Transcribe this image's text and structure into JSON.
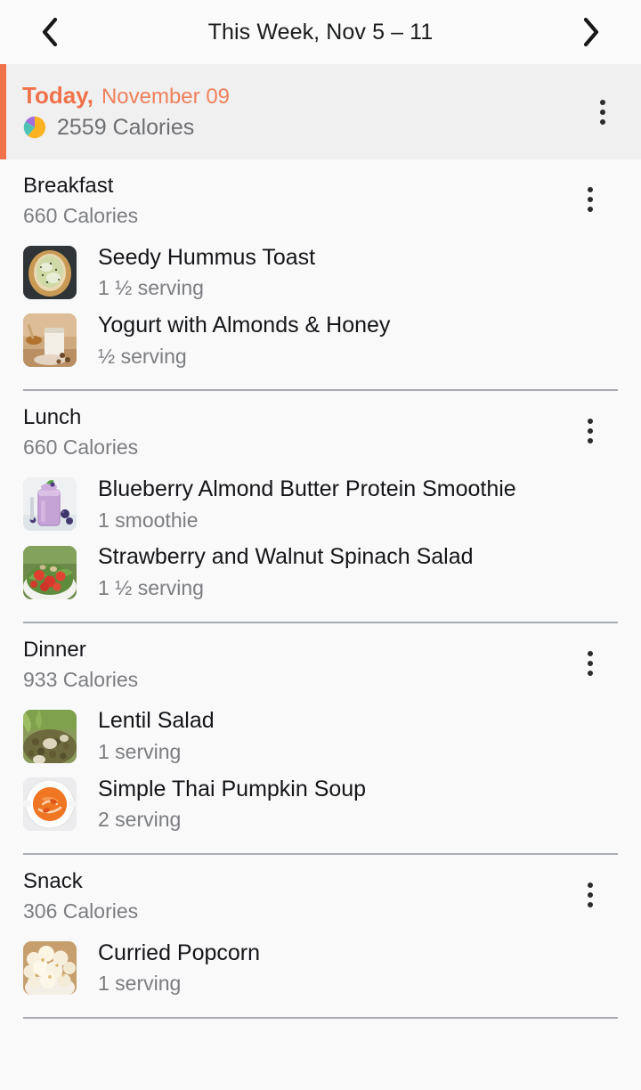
{
  "topbar": {
    "prev_label": "‹",
    "next_label": "›",
    "title": "This Week, Nov 5 – 11"
  },
  "today": {
    "label": "Today,",
    "date": "November 09",
    "calories": "2559 Calories",
    "accent_color": "#f0724a",
    "pie_colors": [
      "#a36fdd",
      "#fbb323",
      "#4ec3b6"
    ]
  },
  "meals": [
    {
      "name": "Breakfast",
      "calories": "660 Calories",
      "items": [
        {
          "name": "Seedy Hummus Toast",
          "serving": "1 ½ serving",
          "thumb": "toast"
        },
        {
          "name": "Yogurt with Almonds & Honey",
          "serving": "½ serving",
          "thumb": "yogurt"
        }
      ]
    },
    {
      "name": "Lunch",
      "calories": "660 Calories",
      "items": [
        {
          "name": "Blueberry Almond Butter Protein Smoothie",
          "serving": "1 smoothie",
          "thumb": "smoothie"
        },
        {
          "name": "Strawberry and Walnut Spinach Salad",
          "serving": "1 ½ serving",
          "thumb": "berry-salad"
        }
      ]
    },
    {
      "name": "Dinner",
      "calories": "933 Calories",
      "items": [
        {
          "name": "Lentil Salad",
          "serving": "1 serving",
          "thumb": "lentil"
        },
        {
          "name": "Simple Thai Pumpkin Soup",
          "serving": "2 serving",
          "thumb": "soup"
        }
      ]
    },
    {
      "name": "Snack",
      "calories": "306 Calories",
      "items": [
        {
          "name": "Curried Popcorn",
          "serving": "1 serving",
          "thumb": "popcorn"
        }
      ]
    }
  ],
  "icons": {
    "kebab": "more-vertical",
    "pie": "calorie-pie-chart",
    "prev": "chevron-left",
    "next": "chevron-right"
  }
}
